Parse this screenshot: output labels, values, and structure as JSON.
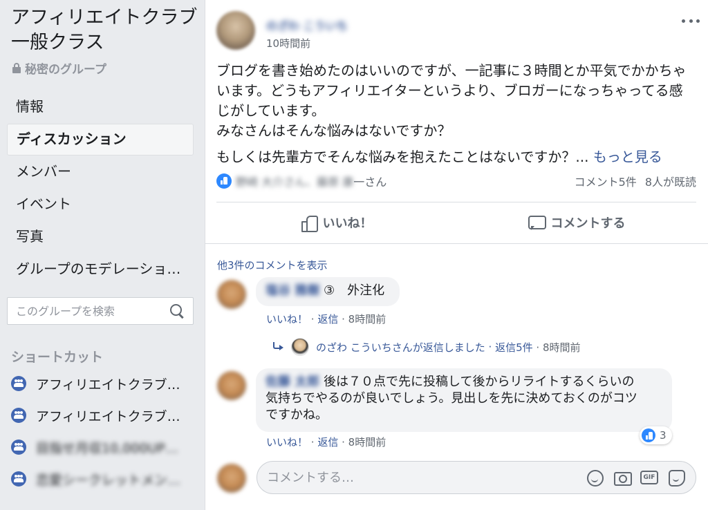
{
  "sidebar": {
    "group_title": "アフィリエイトクラブ一般クラス",
    "privacy": "秘密のグループ",
    "nav": [
      "情報",
      "ディスカッション",
      "メンバー",
      "イベント",
      "写真",
      "グループのモデレーショ…"
    ],
    "active_nav": "ディスカッション",
    "search_placeholder": "このグループを検索",
    "shortcuts_title": "ショートカット",
    "shortcuts": [
      "アフィリエイトクラブ…",
      "アフィリエイトクラブ…",
      "目指せ月収10,000UP…",
      "恋愛シークレットメン…"
    ]
  },
  "post": {
    "author": "のざわ こういち",
    "timestamp": "10時間前",
    "body_lines": [
      "ブログを書き始めたのはいいのですが、一記事に３時間とか平気でかかちゃ",
      "います。どうもアフィリエイターというより、ブロガーになっちゃってる感",
      "じがしています。",
      "みなさんはそんな悩みはないですか？"
    ],
    "body_last": "もしくは先輩方でそんな悩みを抱えたことはないですか？...",
    "see_more": "もっと見る",
    "reactors_blurred": "野崎 大介さん、藤原 康",
    "reactors_suffix": "一さん",
    "comment_count": "コメント5件",
    "seen_count": "8人が既読",
    "like_label": "いいね！",
    "comment_label": "コメントする"
  },
  "comments": {
    "view_more": "他3件のコメントを表示",
    "c1": {
      "name": "塩谷 雅樹",
      "text": "③　外注化",
      "like": "いいね！",
      "reply": "返信",
      "time": "8時間前"
    },
    "reply_summary": {
      "text": "のざわ こういちさんが返信しました",
      "count": "返信5件",
      "time": "8時間前"
    },
    "c2": {
      "name": "佐藤 太郎",
      "line1": "後は７０点で先に投稿して後からリライトするくらいの",
      "line2": "気持ちでやるのが良いでしょう。見出しを先に決めておくのがコツ",
      "line3": "ですかね。",
      "like": "いいね！",
      "reply": "返信",
      "time": "8時間前",
      "reactions": "3"
    },
    "composer_placeholder": "コメントする…",
    "gif_label": "GIF"
  },
  "colors": {
    "link": "#385898",
    "like_blue": "#2d88ff",
    "group_icon": "#4267b2",
    "page_bg": "#e9ebee"
  }
}
